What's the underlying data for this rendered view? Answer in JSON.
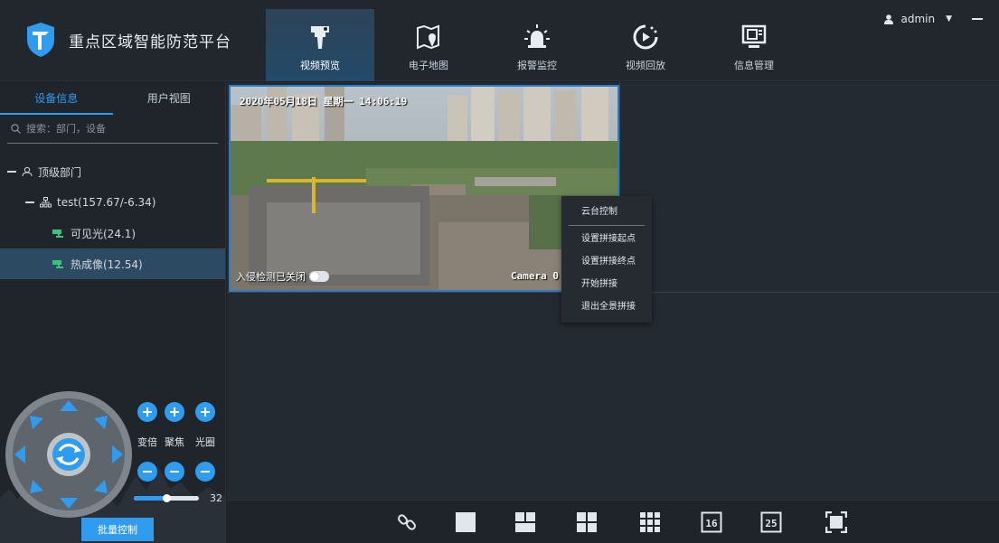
{
  "header": {
    "app_title": "重点区域智能防范平台",
    "nav": [
      {
        "label": "视频预览",
        "icon": "camera-tower-icon"
      },
      {
        "label": "电子地图",
        "icon": "map-pin-icon"
      },
      {
        "label": "报警监控",
        "icon": "alarm-light-icon"
      },
      {
        "label": "视频回放",
        "icon": "playback-icon"
      },
      {
        "label": "信息管理",
        "icon": "monitor-info-icon"
      }
    ],
    "user": "admin"
  },
  "sidebar": {
    "tabs": [
      "设备信息",
      "用户视图"
    ],
    "search_placeholder": "搜索：部门，设备",
    "tree": {
      "root": "顶级部门",
      "group": "test(157.67/-6.34)",
      "devices": [
        "可见光(24.1)",
        "热成像(12.54)"
      ]
    },
    "ptz": {
      "labels": [
        "变倍",
        "聚焦",
        "光圈"
      ],
      "speed": 32,
      "speed_max": 64
    },
    "batch_button": "批量控制"
  },
  "video": {
    "timestamp": "2020年05月18日 星期一 14:06:19",
    "camera_label": "Camera 0",
    "intrusion_label": "入侵检测已关闭"
  },
  "context_menu": {
    "items": [
      "云台控制",
      "设置拼接起点",
      "设置拼接终点",
      "开始拼接",
      "退出全景拼接"
    ]
  },
  "toolbar": {
    "tools": [
      "link-icon",
      "layout-1-icon",
      "layout-3-icon",
      "layout-4-icon",
      "layout-9-icon",
      "layout-16-icon",
      "layout-25-icon",
      "fullscreen-icon"
    ],
    "layout16_label": "16",
    "layout25_label": "25"
  },
  "colors": {
    "accent": "#2f9cf0",
    "selected_row": "#2d4a63",
    "background": "#1e2228"
  }
}
